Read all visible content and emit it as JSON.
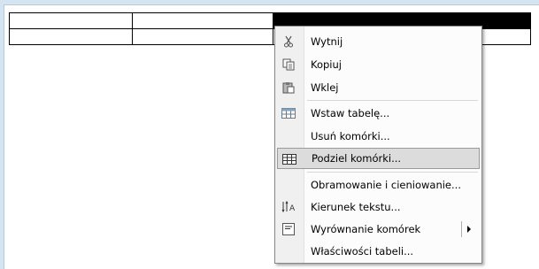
{
  "document": {
    "table_rows": 2,
    "table_cols": 3
  },
  "context_menu": {
    "items": [
      {
        "label": "Wytnij",
        "icon": "scissors-icon"
      },
      {
        "label": "Kopiuj",
        "icon": "copy-icon"
      },
      {
        "label": "Wklej",
        "icon": "paste-icon"
      },
      {
        "label": "Wstaw tabelę...",
        "icon": "insert-table-icon"
      },
      {
        "label": "Usuń komórki...",
        "icon": ""
      },
      {
        "label": "Podziel komórki...",
        "icon": "split-cells-icon",
        "highlighted": true
      },
      {
        "label": "Obramowanie i cieniowanie...",
        "icon": ""
      },
      {
        "label": "Kierunek tekstu...",
        "icon": "text-direction-icon"
      },
      {
        "label": "Wyrównanie komórek",
        "icon": "cell-alignment-icon",
        "submenu": true
      },
      {
        "label": "Właściwości tabeli...",
        "icon": ""
      }
    ]
  },
  "colors": {
    "background": "#d4e4f1",
    "menu_highlight": "#dcdcdc",
    "selected_cell": "#000000"
  }
}
